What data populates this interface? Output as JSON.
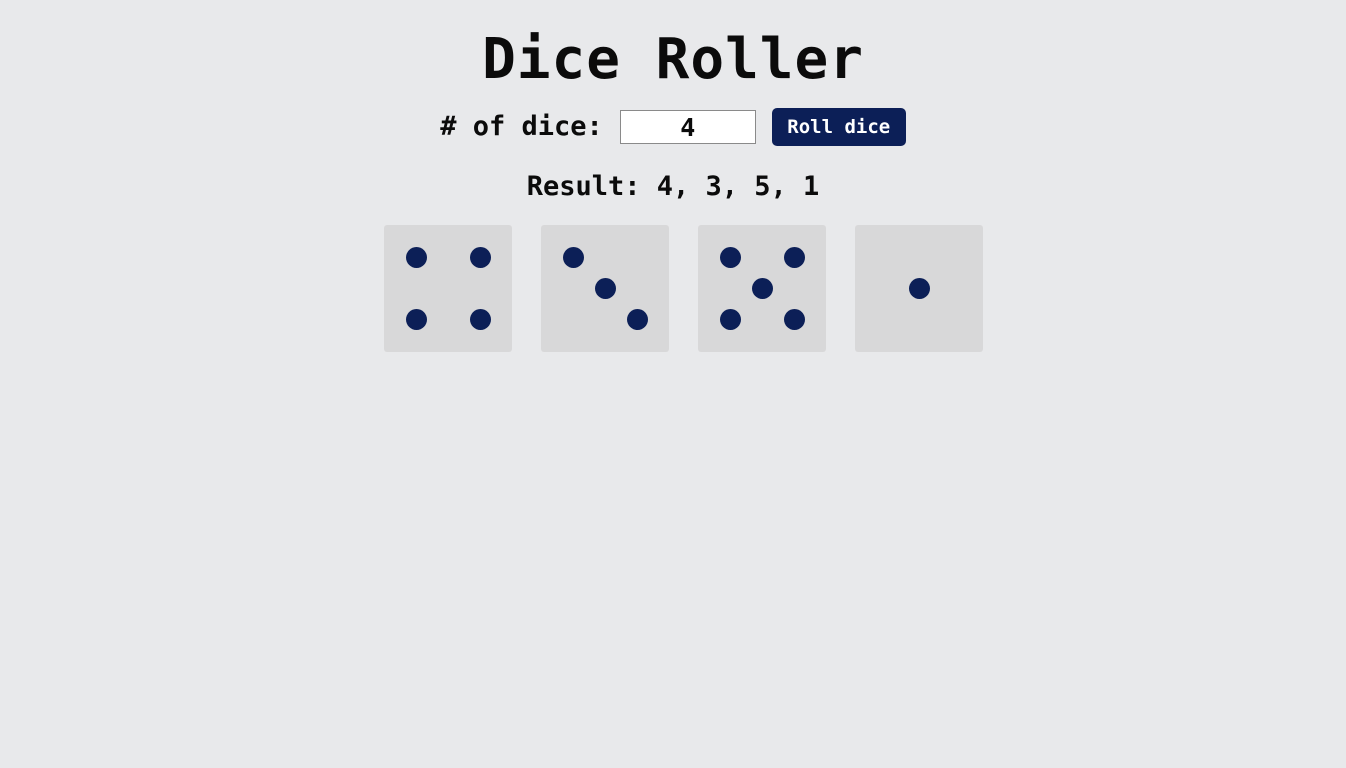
{
  "page": {
    "title": "Dice Roller"
  },
  "controls": {
    "dice_count_label": "# of dice:",
    "dice_count_value": "4",
    "roll_button_label": "Roll dice"
  },
  "result": {
    "text": "Result: 4, 3, 5, 1",
    "values": [
      4,
      3,
      5,
      1
    ]
  },
  "dice": [
    {
      "value": 4
    },
    {
      "value": 3
    },
    {
      "value": 5
    },
    {
      "value": 1
    }
  ],
  "colors": {
    "background": "#e8e9eb",
    "die_face": "#d8d8d9",
    "pip": "#0c1f57",
    "button": "#0c1f57",
    "button_text": "#ffffff"
  }
}
